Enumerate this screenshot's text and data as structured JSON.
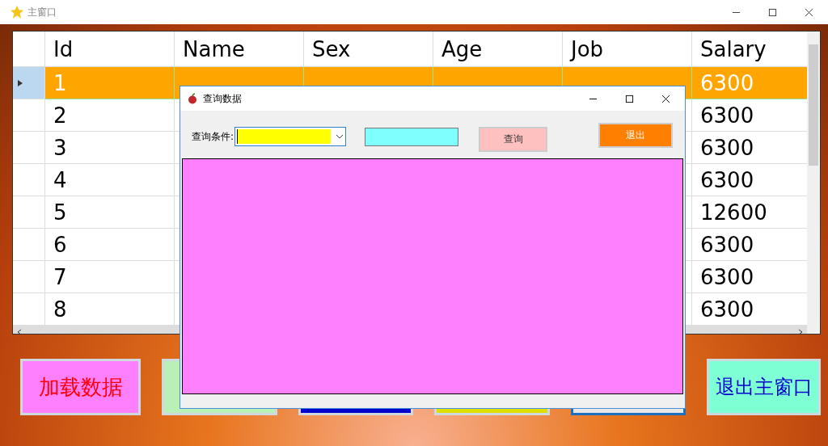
{
  "window": {
    "title": "主窗口"
  },
  "table": {
    "columns": [
      "Id",
      "Name",
      "Sex",
      "Age",
      "Job",
      "Salary"
    ],
    "rows": [
      {
        "id": "1",
        "salary": "6300",
        "selected": true
      },
      {
        "id": "2",
        "salary": "6300",
        "selected": false
      },
      {
        "id": "3",
        "salary": "6300",
        "selected": false
      },
      {
        "id": "4",
        "salary": "6300",
        "selected": false
      },
      {
        "id": "5",
        "salary": "12600",
        "selected": false
      },
      {
        "id": "6",
        "salary": "6300",
        "selected": false
      },
      {
        "id": "7",
        "salary": "6300",
        "selected": false
      },
      {
        "id": "8",
        "salary": "6300",
        "selected": false
      }
    ]
  },
  "buttons": {
    "load": "加载数据",
    "exit": "退出主窗口"
  },
  "dialog": {
    "title": "查询数据",
    "condition_label": "查询条件:",
    "query_button": "查询",
    "exit_button": "退出"
  }
}
